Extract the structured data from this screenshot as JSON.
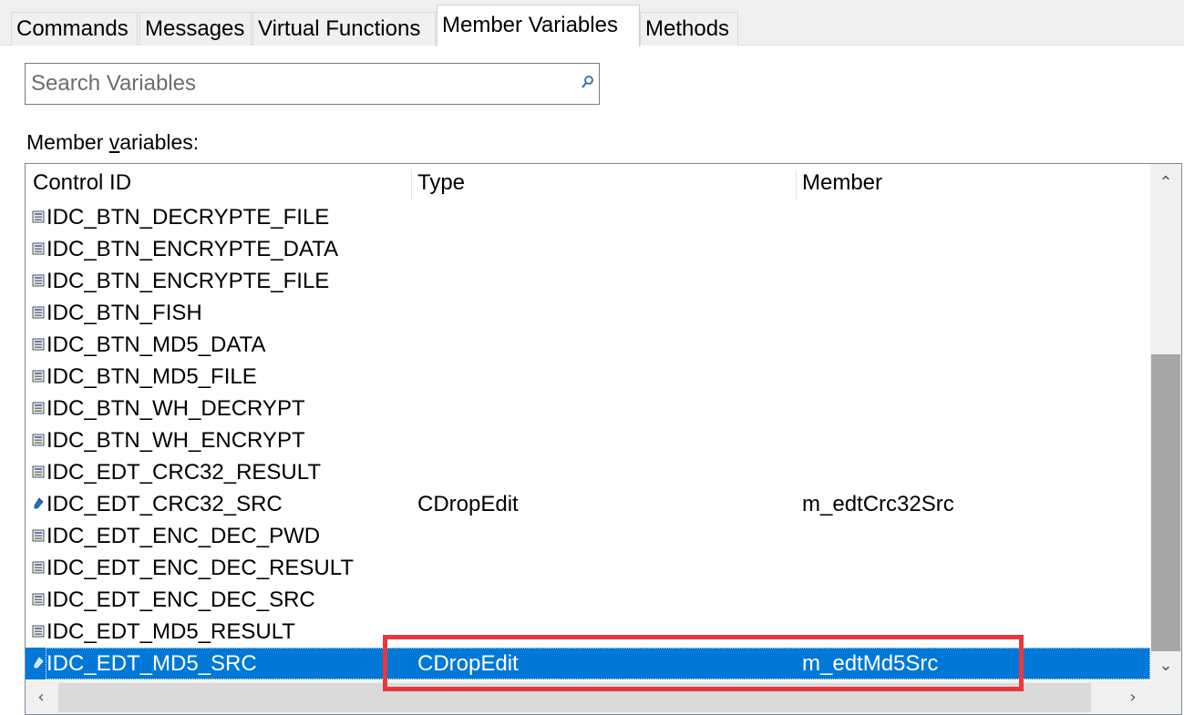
{
  "tabs": [
    {
      "label": "Commands",
      "active": false
    },
    {
      "label": "Messages",
      "active": false
    },
    {
      "label": "Virtual Functions",
      "active": false
    },
    {
      "label": "Member Variables",
      "active": true
    },
    {
      "label": "Methods",
      "active": false
    }
  ],
  "search": {
    "placeholder": "Search Variables",
    "value": ""
  },
  "section_label": {
    "prefix": "Member ",
    "underlined": "v",
    "suffix": "ariables:"
  },
  "columns": {
    "control_id": "Control ID",
    "type": "Type",
    "member": "Member"
  },
  "rows": [
    {
      "id": "IDC_BTN_DECRYPTE_FILE",
      "type": "",
      "member": "",
      "icon": "button-control-icon"
    },
    {
      "id": "IDC_BTN_ENCRYPTE_DATA",
      "type": "",
      "member": "",
      "icon": "button-control-icon"
    },
    {
      "id": "IDC_BTN_ENCRYPTE_FILE",
      "type": "",
      "member": "",
      "icon": "button-control-icon"
    },
    {
      "id": "IDC_BTN_FISH",
      "type": "",
      "member": "",
      "icon": "button-control-icon"
    },
    {
      "id": "IDC_BTN_MD5_DATA",
      "type": "",
      "member": "",
      "icon": "button-control-icon"
    },
    {
      "id": "IDC_BTN_MD5_FILE",
      "type": "",
      "member": "",
      "icon": "button-control-icon"
    },
    {
      "id": "IDC_BTN_WH_DECRYPT",
      "type": "",
      "member": "",
      "icon": "button-control-icon"
    },
    {
      "id": "IDC_BTN_WH_ENCRYPT",
      "type": "",
      "member": "",
      "icon": "button-control-icon"
    },
    {
      "id": "IDC_EDT_CRC32_RESULT",
      "type": "",
      "member": "",
      "icon": "button-control-icon"
    },
    {
      "id": "IDC_EDT_CRC32_SRC",
      "type": "CDropEdit",
      "member": "m_edtCrc32Src",
      "icon": "member-variable-icon"
    },
    {
      "id": "IDC_EDT_ENC_DEC_PWD",
      "type": "",
      "member": "",
      "icon": "button-control-icon"
    },
    {
      "id": "IDC_EDT_ENC_DEC_RESULT",
      "type": "",
      "member": "",
      "icon": "button-control-icon"
    },
    {
      "id": "IDC_EDT_ENC_DEC_SRC",
      "type": "",
      "member": "",
      "icon": "button-control-icon"
    },
    {
      "id": "IDC_EDT_MD5_RESULT",
      "type": "",
      "member": "",
      "icon": "button-control-icon"
    },
    {
      "id": "IDC_EDT_MD5_SRC",
      "type": "CDropEdit",
      "member": "m_edtMd5Src",
      "icon": "member-variable-icon",
      "selected": true
    }
  ],
  "colors": {
    "selection": "#0078d7",
    "annotation": "#e8383d",
    "tab_bg": "#f0f0f0"
  },
  "icons": {
    "search": "search-icon",
    "scroll_up": "chevron-up-icon",
    "scroll_down": "chevron-down-icon",
    "scroll_left": "chevron-left-icon",
    "scroll_right": "chevron-right-icon"
  }
}
